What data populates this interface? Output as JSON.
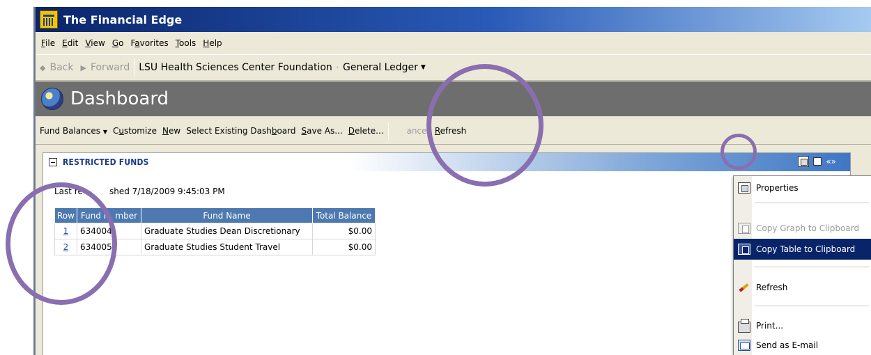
{
  "window": {
    "title": "The Financial Edge"
  },
  "menubar": [
    {
      "pre": "",
      "ul": "F",
      "post": "ile"
    },
    {
      "pre": "",
      "ul": "E",
      "post": "dit"
    },
    {
      "pre": "",
      "ul": "V",
      "post": "iew"
    },
    {
      "pre": "",
      "ul": "G",
      "post": "o"
    },
    {
      "pre": "F",
      "ul": "a",
      "post": "vorites"
    },
    {
      "pre": "",
      "ul": "T",
      "post": "ools"
    },
    {
      "pre": "",
      "ul": "H",
      "post": "elp"
    }
  ],
  "nav": {
    "back_label": "Back",
    "forward_label": "Forward",
    "breadcrumb_org": "LSU Health Sciences Center Foundation",
    "breadcrumb_module": "General Ledger"
  },
  "dashboard": {
    "title": "Dashboard"
  },
  "toolbar": {
    "fund_balances": "Fund Balances",
    "customize": {
      "pre": "C",
      "ul": "u",
      "post": "stomize"
    },
    "new": {
      "pre": "",
      "ul": "N",
      "post": "ew"
    },
    "select_existing": {
      "pre": "Select Existing Dash",
      "ul": "b",
      "post": "oard"
    },
    "save_as": {
      "pre": "",
      "ul": "S",
      "post": "ave As..."
    },
    "delete": {
      "pre": "",
      "ul": "D",
      "post": "elete..."
    },
    "cancel": "ancel",
    "refresh": {
      "pre": "",
      "ul": "R",
      "post": "efresh"
    }
  },
  "panel": {
    "title": "RESTRICTED FUNDS",
    "chevrons": "«»",
    "last_refreshed": "Last re          shed 7/18/2009 9:45:03 PM"
  },
  "table": {
    "headers": [
      "Row",
      "Fund N  mber",
      "Fund Name",
      "Total Balance"
    ],
    "rows": [
      {
        "row": "1",
        "fund_number": "634004",
        "fund_name": "Graduate Studies Dean Discretionary",
        "balance": "$0.00"
      },
      {
        "row": "2",
        "fund_number": "634005",
        "fund_name": "Graduate Studies Student Travel",
        "balance": "$0.00"
      }
    ]
  },
  "context_menu": {
    "properties": "Properties",
    "copy_graph": "Copy Graph to Clipboard",
    "copy_table": "Copy Table to Clipboard",
    "refresh": "Refresh",
    "print": "Print...",
    "send_email": "Send as E-mail"
  },
  "colors": {
    "titlebar": "#0a246a",
    "header_gray": "#6e6e6e",
    "table_header": "#4d79b0",
    "menu_highlight": "#0a246a",
    "annotation_ring": "#8a6fb0"
  }
}
